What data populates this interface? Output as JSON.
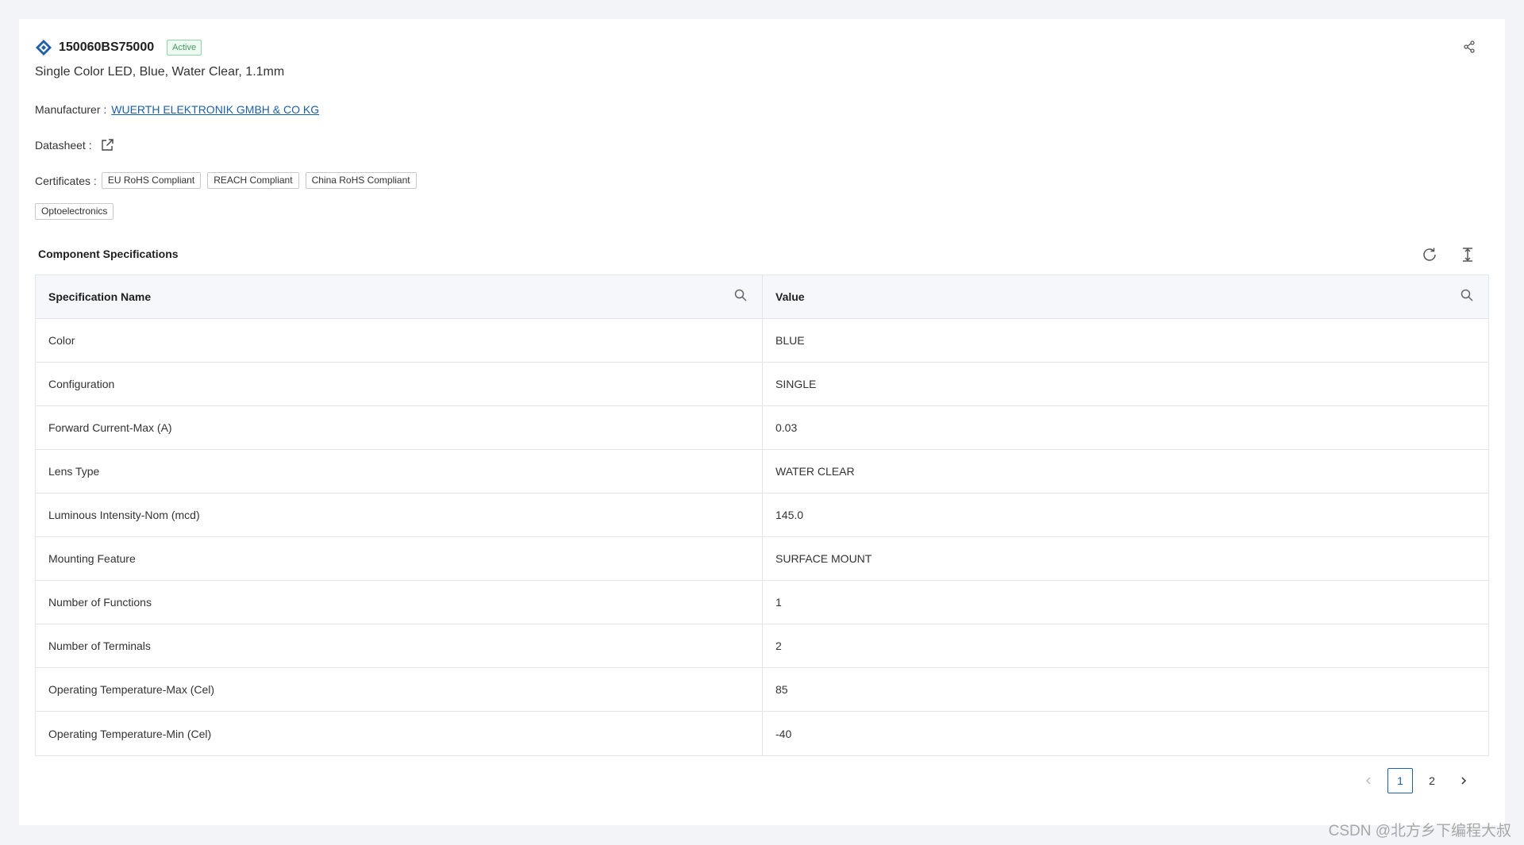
{
  "header": {
    "part_number": "150060BS75000",
    "status": "Active",
    "description": "Single Color LED, Blue, Water Clear, 1.1mm"
  },
  "manufacturer": {
    "label": "Manufacturer :",
    "name": "WUERTH ELEKTRONIK GMBH & CO KG"
  },
  "datasheet": {
    "label": "Datasheet :"
  },
  "certificates": {
    "label": "Certificates :",
    "items": [
      "EU RoHS Compliant",
      "REACH Compliant",
      "China RoHS Compliant"
    ]
  },
  "category_tag": "Optoelectronics",
  "specs": {
    "title": "Component Specifications",
    "columns": [
      "Specification Name",
      "Value"
    ],
    "rows": [
      [
        "Color",
        "BLUE"
      ],
      [
        "Configuration",
        "SINGLE"
      ],
      [
        "Forward Current-Max (A)",
        "0.03"
      ],
      [
        "Lens Type",
        "WATER CLEAR"
      ],
      [
        "Luminous Intensity-Nom (mcd)",
        "145.0"
      ],
      [
        "Mounting Feature",
        "SURFACE MOUNT"
      ],
      [
        "Number of Functions",
        "1"
      ],
      [
        "Number of Terminals",
        "2"
      ],
      [
        "Operating Temperature-Max (Cel)",
        "85"
      ],
      [
        "Operating Temperature-Min (Cel)",
        "-40"
      ]
    ]
  },
  "pagination": {
    "pages": [
      "1",
      "2"
    ],
    "current": "1"
  },
  "watermark": "CSDN @北方乡下编程大叔",
  "colors": {
    "accent": "#1d5fa8",
    "status_green": "#3f9b5e",
    "border": "#e3e5ea"
  }
}
